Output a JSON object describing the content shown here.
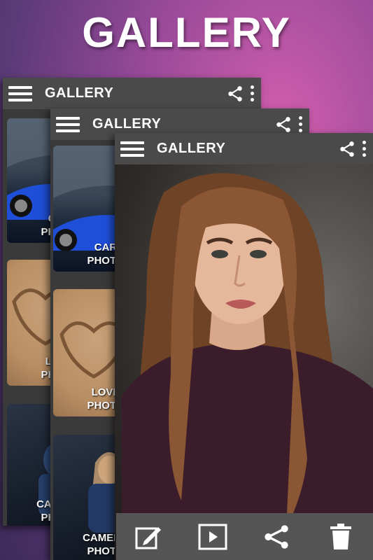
{
  "headline": "GALLERY",
  "windows": [
    {
      "title": "GALLERY",
      "tiles": [
        {
          "label_line1": "CAR",
          "label_line2": "PHOTO"
        },
        {
          "label_line1": "LOVE",
          "label_line2": "PHOTO"
        },
        {
          "label_line1": "CAMERA",
          "label_line2": "PHOTO"
        }
      ]
    },
    {
      "title": "GALLERY",
      "tiles": [
        {
          "label_line1": "CAR",
          "label_line2": "PHOTO"
        },
        {
          "label_line1": "LOVE",
          "label_line2": "PHOTO"
        },
        {
          "label_line1": "CAMERA",
          "label_line2": "PHOTO"
        }
      ]
    },
    {
      "title": "GALLERY"
    }
  ],
  "icons": {
    "menu": "hamburger-icon",
    "share": "share-icon",
    "more": "more-vert-icon",
    "edit": "edit-icon",
    "slideshow": "play-icon",
    "bottom_share": "share-icon",
    "delete": "trash-icon"
  },
  "colors": {
    "appbar": "#4a4a4a",
    "bottombar": "#555555",
    "text": "#ffffff"
  }
}
